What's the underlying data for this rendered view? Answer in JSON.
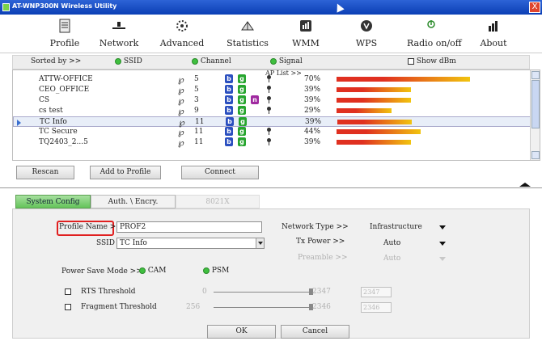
{
  "window": {
    "title": "AT-WNP300N Wireless Utility",
    "close": "X"
  },
  "toolbar": {
    "items": [
      {
        "label": "Profile",
        "icon": "profile-icon"
      },
      {
        "label": "Network",
        "icon": "network-icon",
        "active": true
      },
      {
        "label": "Advanced",
        "icon": "advanced-icon"
      },
      {
        "label": "Statistics",
        "icon": "statistics-icon"
      },
      {
        "label": "WMM",
        "icon": "wmm-icon"
      },
      {
        "label": "WPS",
        "icon": "wps-icon"
      },
      {
        "label": "Radio on/off",
        "icon": "radio-icon"
      },
      {
        "label": "About",
        "icon": "about-icon"
      }
    ]
  },
  "sortbar": {
    "sorted_by": "Sorted by >>",
    "ssid": "SSID",
    "channel": "Channel",
    "signal": "Signal",
    "show_dbm": "Show dBm",
    "ap_list": "AP List >>"
  },
  "aplist": {
    "rows": [
      {
        "ssid": "ATTW-OFFICE",
        "channel": "5",
        "b": true,
        "g": true,
        "n": false,
        "secure": true,
        "signal": "70%",
        "signal_value": 0.7
      },
      {
        "ssid": "CEO_OFFICE",
        "channel": "5",
        "b": true,
        "g": true,
        "n": false,
        "secure": true,
        "signal": "39%",
        "signal_value": 0.39
      },
      {
        "ssid": "CS",
        "channel": "3",
        "b": true,
        "g": true,
        "n": true,
        "secure": true,
        "signal": "39%",
        "signal_value": 0.39
      },
      {
        "ssid": "cs test",
        "channel": "9",
        "b": true,
        "g": true,
        "n": false,
        "secure": true,
        "signal": "29%",
        "signal_value": 0.29
      },
      {
        "ssid": "TC Info",
        "channel": "11",
        "b": true,
        "g": true,
        "n": false,
        "secure": false,
        "signal": "39%",
        "signal_value": 0.39,
        "selected": true
      },
      {
        "ssid": "TC Secure",
        "channel": "11",
        "b": true,
        "g": true,
        "n": false,
        "secure": true,
        "signal": "44%",
        "signal_value": 0.44
      },
      {
        "ssid": "TQ2403_2...5",
        "channel": "11",
        "b": true,
        "g": true,
        "n": false,
        "secure": true,
        "signal": "39%",
        "signal_value": 0.39
      }
    ]
  },
  "actions": {
    "rescan": "Rescan",
    "add_to_profile": "Add to Profile",
    "connect": "Connect"
  },
  "tabs": {
    "system_config": "System Config",
    "auth": "Auth. \\ Encry.",
    "dot1x": "8021X"
  },
  "config": {
    "profile_name_label": "Profile Name >>",
    "profile_name": "PROF2",
    "ssid_label": "SSID >>",
    "ssid": "TC Info",
    "network_type_label": "Network Type >>",
    "network_type": "Infrastructure",
    "tx_power_label": "Tx Power >>",
    "tx_power": "Auto",
    "preamble_label": "Preamble >>",
    "preamble": "Auto",
    "power_save_label": "Power Save Mode >>",
    "cam": "CAM",
    "psm": "PSM",
    "rts_label": "RTS Threshold",
    "rts_min": "0",
    "rts_max": "2347",
    "rts_value": "2347",
    "frag_label": "Fragment Threshold",
    "frag_min": "256",
    "frag_max": "2346",
    "frag_value": "2346"
  },
  "footer": {
    "ok": "OK",
    "cancel": "Cancel"
  },
  "colors": {
    "title_bar": "#0b3fb5",
    "active_tab": "#64c45a",
    "signal_red": "#e03020",
    "signal_yellow": "#f1c40f",
    "highlight": "#e02020"
  }
}
